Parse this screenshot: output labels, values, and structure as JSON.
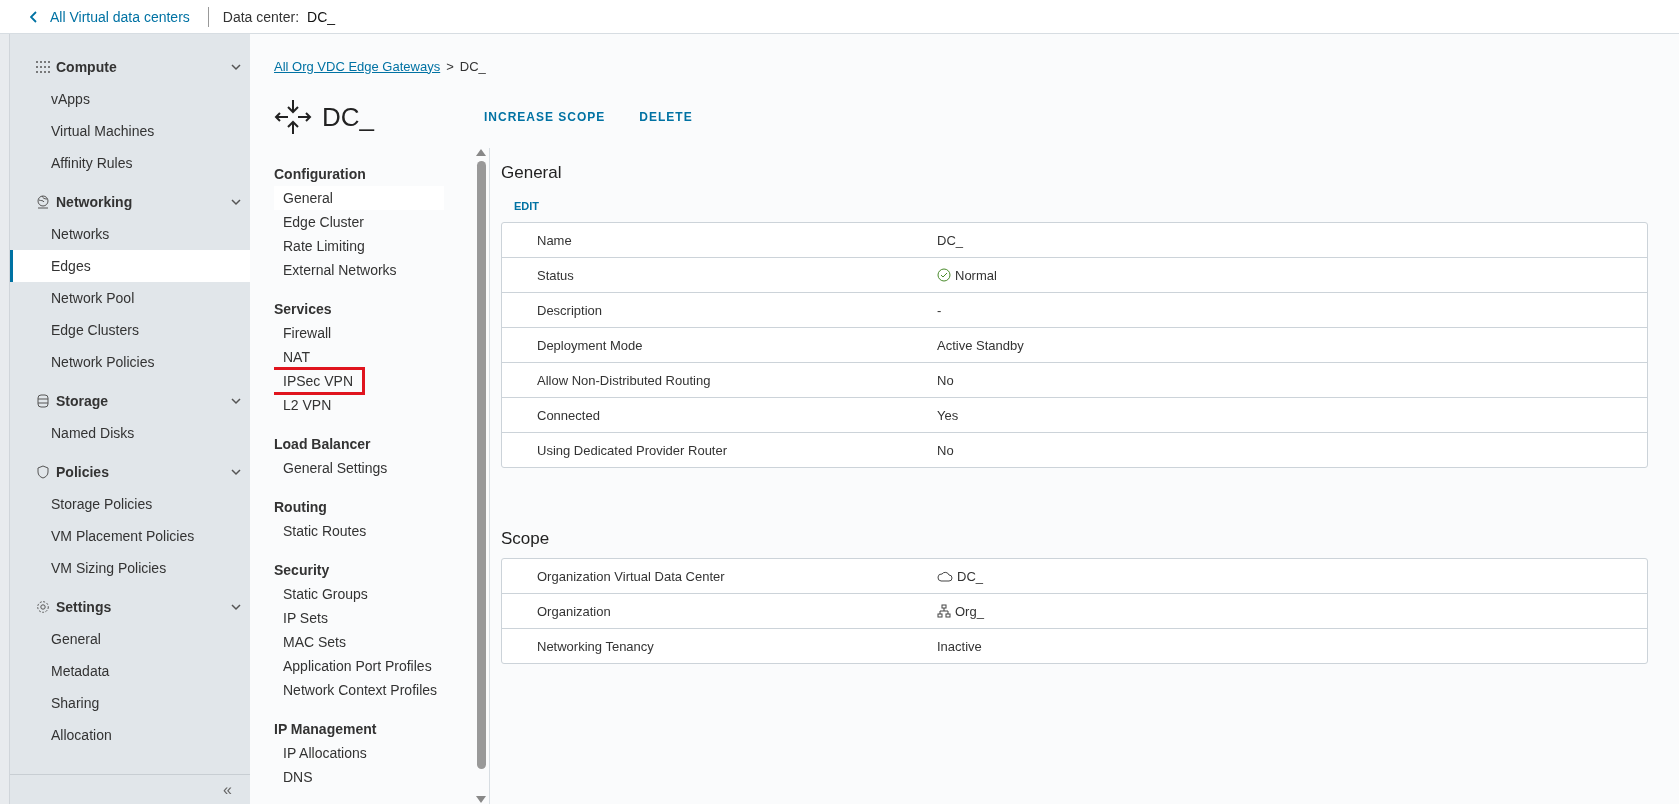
{
  "header": {
    "back_link": "All Virtual data centers",
    "context_label": "Data center:",
    "context_value": "DC_"
  },
  "sidebar": {
    "groups": [
      {
        "label": "Compute",
        "expanded": true,
        "items": [
          {
            "label": "vApps",
            "selected": false
          },
          {
            "label": "Virtual Machines",
            "selected": false
          },
          {
            "label": "Affinity Rules",
            "selected": false
          }
        ]
      },
      {
        "label": "Networking",
        "expanded": true,
        "items": [
          {
            "label": "Networks",
            "selected": false
          },
          {
            "label": "Edges",
            "selected": true
          },
          {
            "label": "Network Pool",
            "selected": false
          },
          {
            "label": "Edge Clusters",
            "selected": false
          },
          {
            "label": "Network Policies",
            "selected": false
          }
        ]
      },
      {
        "label": "Storage",
        "expanded": true,
        "items": [
          {
            "label": "Named Disks",
            "selected": false
          }
        ]
      },
      {
        "label": "Policies",
        "expanded": true,
        "items": [
          {
            "label": "Storage Policies",
            "selected": false
          },
          {
            "label": "VM Placement Policies",
            "selected": false
          },
          {
            "label": "VM Sizing Policies",
            "selected": false
          }
        ]
      },
      {
        "label": "Settings",
        "expanded": true,
        "items": [
          {
            "label": "General",
            "selected": false
          },
          {
            "label": "Metadata",
            "selected": false
          },
          {
            "label": "Sharing",
            "selected": false
          },
          {
            "label": "Allocation",
            "selected": false
          }
        ]
      }
    ],
    "collapse_glyph": "«"
  },
  "breadcrumb": {
    "link": "All Org VDC Edge Gateways",
    "separator": ">",
    "current": "DC_"
  },
  "title": "DC_",
  "actions": [
    "INCREASE SCOPE",
    "DELETE"
  ],
  "nav": {
    "sections": [
      {
        "title": "Configuration",
        "items": [
          {
            "label": "General",
            "selected": true,
            "highlighted": false
          },
          {
            "label": "Edge Cluster",
            "selected": false,
            "highlighted": false
          },
          {
            "label": "Rate Limiting",
            "selected": false,
            "highlighted": false
          },
          {
            "label": "External Networks",
            "selected": false,
            "highlighted": false
          }
        ]
      },
      {
        "title": "Services",
        "items": [
          {
            "label": "Firewall",
            "selected": false,
            "highlighted": false
          },
          {
            "label": "NAT",
            "selected": false,
            "highlighted": false
          },
          {
            "label": "IPSec VPN",
            "selected": false,
            "highlighted": true
          },
          {
            "label": "L2 VPN",
            "selected": false,
            "highlighted": false
          }
        ]
      },
      {
        "title": "Load Balancer",
        "items": [
          {
            "label": "General Settings",
            "selected": false,
            "highlighted": false
          }
        ]
      },
      {
        "title": "Routing",
        "items": [
          {
            "label": "Static Routes",
            "selected": false,
            "highlighted": false
          }
        ]
      },
      {
        "title": "Security",
        "items": [
          {
            "label": "Static Groups",
            "selected": false,
            "highlighted": false
          },
          {
            "label": "IP Sets",
            "selected": false,
            "highlighted": false
          },
          {
            "label": "MAC Sets",
            "selected": false,
            "highlighted": false
          },
          {
            "label": "Application Port Profiles",
            "selected": false,
            "highlighted": false
          },
          {
            "label": "Network Context Profiles",
            "selected": false,
            "highlighted": false
          }
        ]
      },
      {
        "title": "IP Management",
        "items": [
          {
            "label": "IP Allocations",
            "selected": false,
            "highlighted": false
          },
          {
            "label": "DNS",
            "selected": false,
            "highlighted": false
          }
        ]
      }
    ]
  },
  "panels": [
    {
      "title": "General",
      "action": "EDIT",
      "rows": [
        {
          "label": "Name",
          "value": "DC_",
          "kind": "text"
        },
        {
          "label": "Status",
          "value": "Normal",
          "kind": "status"
        },
        {
          "label": "Description",
          "value": "-",
          "kind": "text"
        },
        {
          "label": "Deployment Mode",
          "value": "Active Standby",
          "kind": "text"
        },
        {
          "label": "Allow Non-Distributed Routing",
          "value": "No",
          "kind": "text"
        },
        {
          "label": "Connected",
          "value": "Yes",
          "kind": "text"
        },
        {
          "label": "Using Dedicated Provider Router",
          "value": "No",
          "kind": "text"
        }
      ]
    },
    {
      "title": "Scope",
      "rows": [
        {
          "label": "Organization Virtual Data Center",
          "value": "DC_",
          "kind": "vdc"
        },
        {
          "label": "Organization",
          "value": "Org_",
          "kind": "org"
        },
        {
          "label": "Networking Tenancy",
          "value": "Inactive",
          "kind": "text"
        }
      ]
    }
  ]
}
